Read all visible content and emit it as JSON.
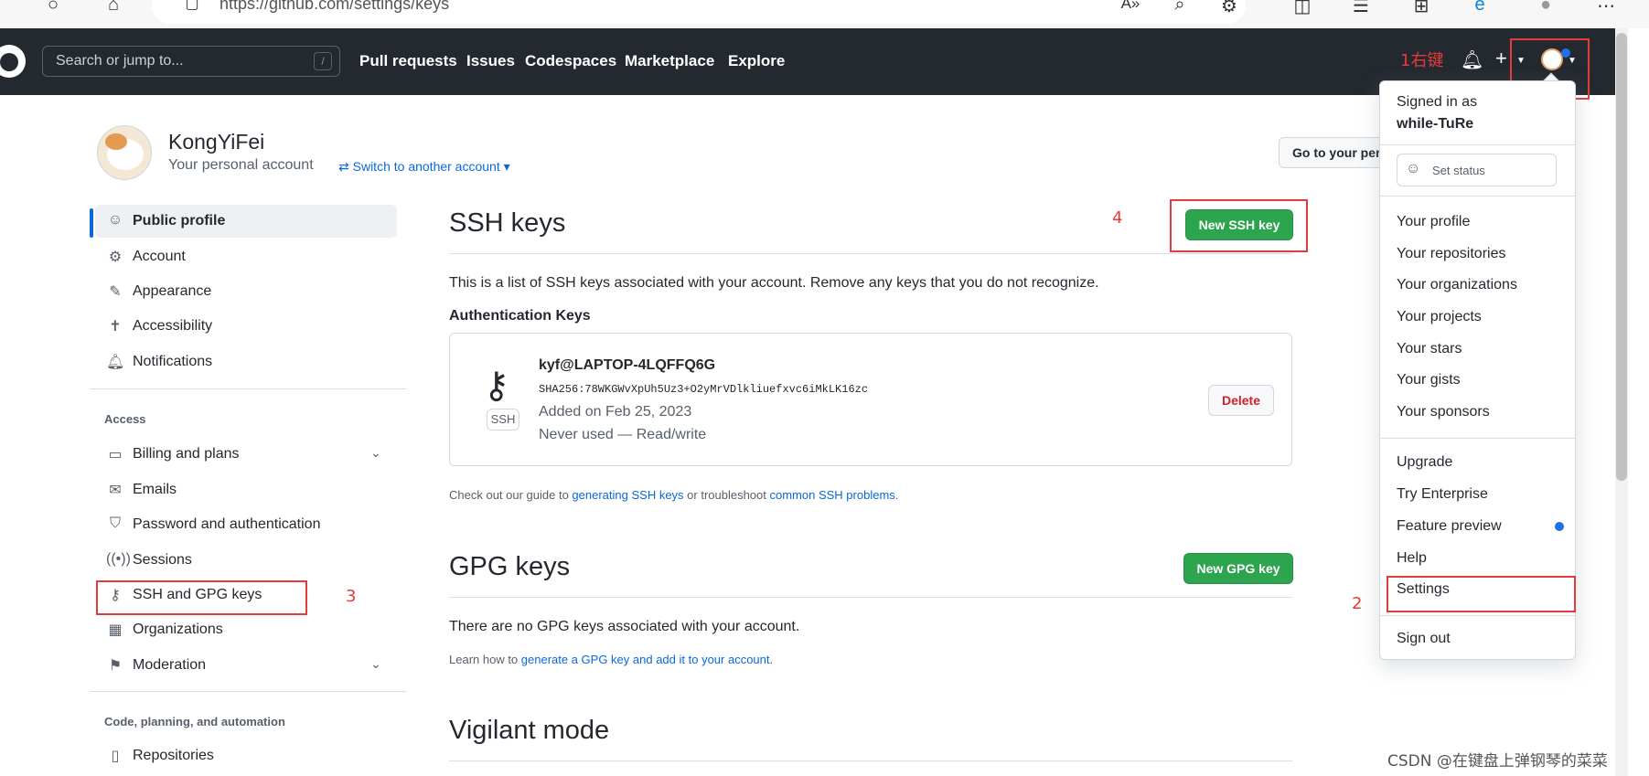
{
  "browser": {
    "url": "https://github.com/settings/keys",
    "icons": [
      "circle-icon",
      "home-icon",
      "page-info-icon",
      "read-aloud-icon",
      "search-page-icon",
      "extension-icon",
      "split-screen-icon",
      "favorites-icon",
      "collections-icon",
      "edge-icon",
      "profile-icon",
      "more-icon"
    ]
  },
  "header": {
    "search_placeholder": "Search or jump to...",
    "slash": "/",
    "nav": [
      "Pull requests",
      "Issues",
      "Codespaces",
      "Marketplace",
      "Explore"
    ],
    "plus": "+"
  },
  "account": {
    "name": "KongYiFei",
    "subtitle": "Your personal account",
    "switch_label": "Switch to another account",
    "goto_label": "Go to your personal profile"
  },
  "sidebar": {
    "top_items": [
      {
        "label": "Public profile",
        "icon": "person-icon",
        "active": true
      },
      {
        "label": "Account",
        "icon": "gear-icon"
      },
      {
        "label": "Appearance",
        "icon": "paintbrush-icon"
      },
      {
        "label": "Accessibility",
        "icon": "accessibility-icon"
      },
      {
        "label": "Notifications",
        "icon": "bell-icon"
      }
    ],
    "group_access": "Access",
    "access_items": [
      {
        "label": "Billing and plans",
        "icon": "credit-card-icon",
        "expandable": true
      },
      {
        "label": "Emails",
        "icon": "mail-icon"
      },
      {
        "label": "Password and authentication",
        "icon": "shield-lock-icon"
      },
      {
        "label": "Sessions",
        "icon": "broadcast-icon"
      },
      {
        "label": "SSH and GPG keys",
        "icon": "key-icon"
      },
      {
        "label": "Organizations",
        "icon": "organization-icon"
      },
      {
        "label": "Moderation",
        "icon": "report-icon",
        "expandable": true
      }
    ],
    "group_code": "Code, planning, and automation",
    "code_items": [
      {
        "label": "Repositories",
        "icon": "repo-icon"
      }
    ]
  },
  "main": {
    "ssh_title": "SSH keys",
    "new_ssh_button": "New SSH key",
    "ssh_description": "This is a list of SSH keys associated with your account. Remove any keys that you do not recognize.",
    "auth_keys_heading": "Authentication Keys",
    "key": {
      "title": "kyf@LAPTOP-4LQFFQ6G",
      "fingerprint": "SHA256:78WKGWvXpUh5Uz3+O2yMrVDlkliuefxvc6iMkLK16zc",
      "added": "Added on Feb 25, 2023",
      "usage": "Never used — Read/write",
      "tag": "SSH",
      "delete_label": "Delete"
    },
    "guide": {
      "prefix": "Check out our guide to ",
      "link1": "generating SSH keys",
      "middle": " or troubleshoot ",
      "link2": "common SSH problems",
      "suffix": "."
    },
    "gpg_title": "GPG keys",
    "new_gpg_button": "New GPG key",
    "gpg_empty": "There are no GPG keys associated with your account.",
    "gpg_learn": {
      "prefix": "Learn how to ",
      "link": "generate a GPG key and add it to your account",
      "suffix": "."
    },
    "vigilant_title": "Vigilant mode"
  },
  "dropdown": {
    "signed_in_as": "Signed in as",
    "username": "while-TuRe",
    "set_status": "Set status",
    "group1": [
      "Your profile",
      "Your repositories",
      "Your organizations",
      "Your projects",
      "Your stars",
      "Your gists",
      "Your sponsors"
    ],
    "group2": [
      "Upgrade",
      "Try Enterprise",
      "Feature preview",
      "Help",
      "Settings"
    ],
    "sign_out": "Sign out"
  },
  "annotations": {
    "step1": "1右键",
    "step2": "2",
    "step3": "3",
    "step4": "4"
  },
  "watermark": "CSDN @在键盘上弹钢琴的菜菜",
  "colors": {
    "header_bg": "#24292f",
    "accent_blue": "#0969da",
    "green_button": "#2da44e",
    "danger": "#cf222e",
    "annotation_red": "#e23b3b"
  }
}
